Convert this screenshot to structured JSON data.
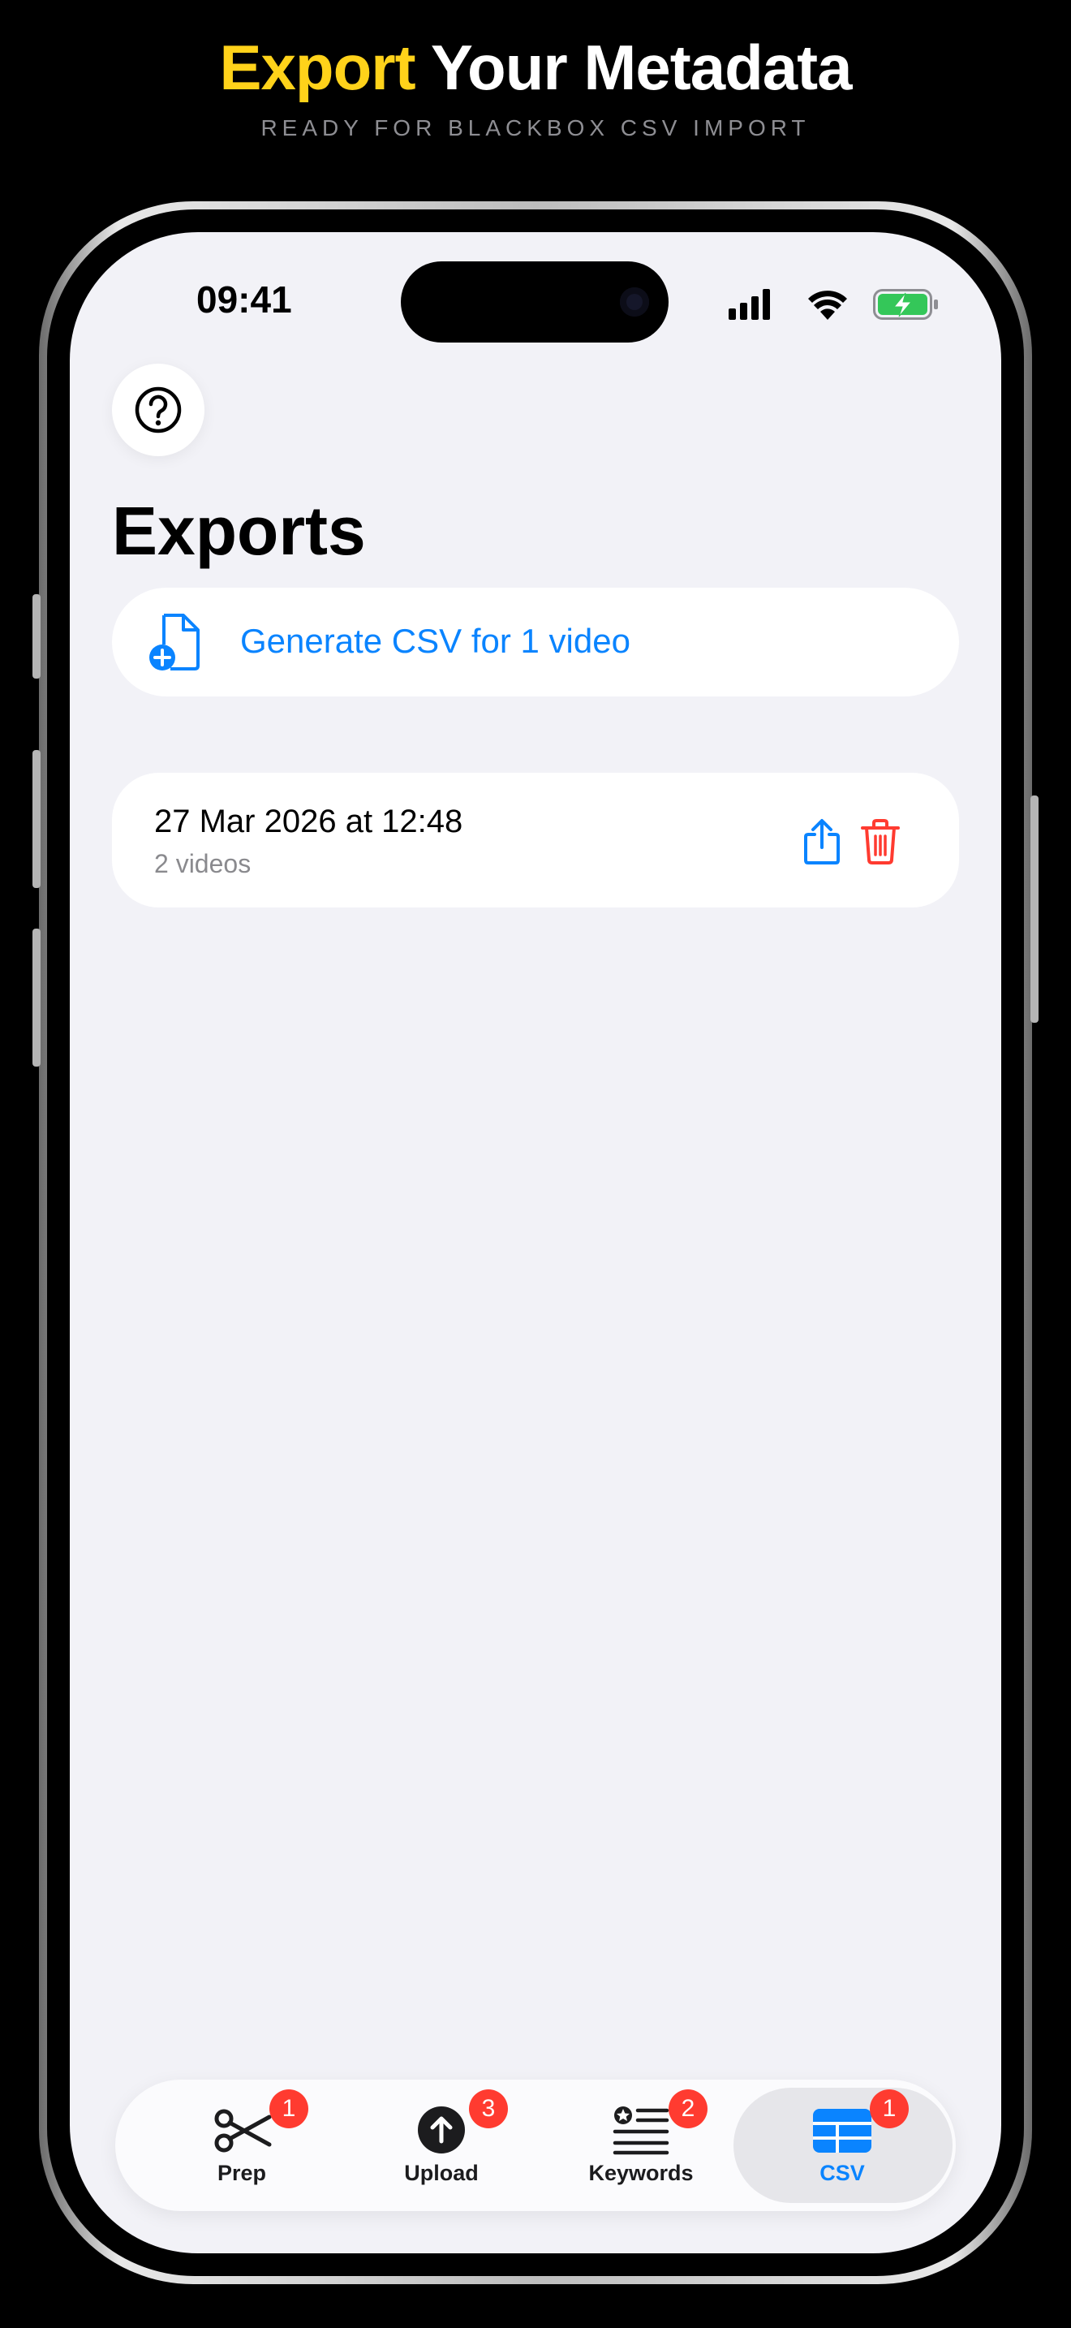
{
  "promo": {
    "headline_highlight": "Export",
    "headline_rest": " Your Metadata",
    "subheadline": "READY FOR BLACKBOX CSV IMPORT",
    "highlight_color": "#FFD21A"
  },
  "status_bar": {
    "time": "09:41",
    "icons": [
      "cellular-signal-icon",
      "wifi-icon",
      "battery-charging-icon"
    ]
  },
  "header": {
    "help_icon": "question-mark-circle-icon",
    "title": "Exports"
  },
  "generate": {
    "icon": "document-add-icon",
    "label": "Generate CSV for 1 video"
  },
  "exports": [
    {
      "date": "27 Mar 2026 at 12:48",
      "count": "2 videos",
      "actions": [
        "share-icon",
        "trash-icon"
      ]
    }
  ],
  "tabbar": {
    "tabs": [
      {
        "label": "Prep",
        "icon": "scissors-icon",
        "badge": "1",
        "active": false
      },
      {
        "label": "Upload",
        "icon": "upload-arrow-icon",
        "badge": "3",
        "active": false
      },
      {
        "label": "Keywords",
        "icon": "keywords-list-icon",
        "badge": "2",
        "active": false
      },
      {
        "label": "CSV",
        "icon": "table-icon",
        "badge": "1",
        "active": true
      }
    ]
  },
  "colors": {
    "accent": "#0a84ff",
    "destructive": "#ff3b30",
    "badge": "#ff3b30",
    "background": "#f2f2f7",
    "battery_green": "#34c759"
  }
}
